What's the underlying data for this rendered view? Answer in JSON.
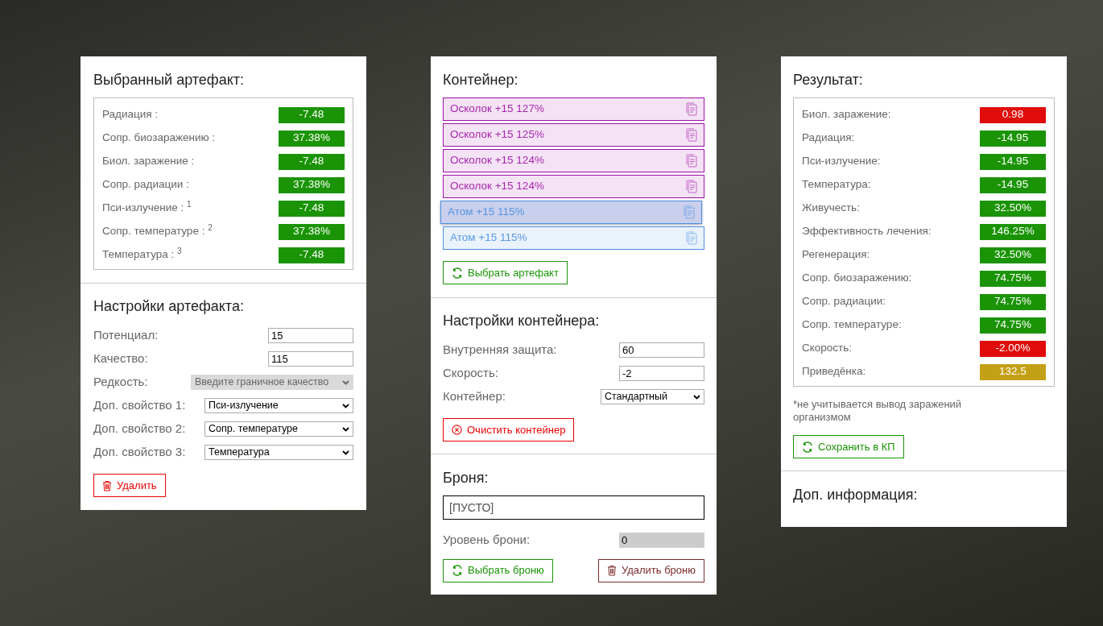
{
  "artifact": {
    "title": "Выбранный артефакт:",
    "stats": [
      {
        "label": "Радиация :",
        "value": "-7.48",
        "color": "#1a9406"
      },
      {
        "label": "Сопр. биозаражению :",
        "value": "37.38%",
        "color": "#1a9406"
      },
      {
        "label": "Биол. заражение :",
        "value": "-7.48",
        "color": "#1a9406"
      },
      {
        "label": "Сопр. радиации :",
        "value": "37.38%",
        "color": "#1a9406"
      },
      {
        "label": "Пси-излучение : $^{1}$",
        "value": "-7.48",
        "color": "#1a9406"
      },
      {
        "label": "Сопр. температуре : $^{2}$",
        "value": "37.38%",
        "color": "#1a9406"
      },
      {
        "label": "Температура : $^{3}$",
        "value": "-7.48",
        "color": "#1a9406"
      }
    ]
  },
  "artifact_settings": {
    "title": "Настройки артефакта:",
    "fields": [
      {
        "kind": "input",
        "label": "Потенциал:",
        "value": "15"
      },
      {
        "kind": "input",
        "label": "Качество:",
        "value": "115"
      },
      {
        "kind": "select",
        "label": "Редкость:",
        "value": "Введите граничное качество",
        "disabled": true
      },
      {
        "kind": "select",
        "label": "Доп. свойство 1:",
        "value": "Пси-излучение",
        "disabled": false
      },
      {
        "kind": "select",
        "label": "Доп. свойство 2:",
        "value": "Сопр. температуре",
        "disabled": false
      },
      {
        "kind": "select",
        "label": "Доп. свойство 3:",
        "value": "Температура",
        "disabled": false
      }
    ],
    "delete_button": "Удалить"
  },
  "container": {
    "title": "Контейнер:",
    "items": [
      {
        "label": "Осколок +15 127%",
        "color": "#a010a8",
        "selected": false
      },
      {
        "label": "Осколок +15 125%",
        "color": "#a010a8",
        "selected": false
      },
      {
        "label": "Осколок +15 124%",
        "color": "#a010a8",
        "selected": false
      },
      {
        "label": "Осколок +15 124%",
        "color": "#a010a8",
        "selected": false
      },
      {
        "label": "Атом +15 115%",
        "color": "#4a90e2",
        "selected": true
      },
      {
        "label": "Атом +15 115%",
        "color": "#4a90e2",
        "selected": false
      }
    ],
    "choose_button": "Выбрать артефакт"
  },
  "container_settings": {
    "title": "Настройки контейнера:",
    "fields": [
      {
        "kind": "input",
        "label": "Внутренняя защита:",
        "value": "60"
      },
      {
        "kind": "input",
        "label": "Скорость:",
        "value": "-2"
      },
      {
        "kind": "select",
        "label": "Контейнер:",
        "value": "Стандартный",
        "disabled": false
      }
    ],
    "clear_button": "Очистить контейнер"
  },
  "armor": {
    "title": "Броня:",
    "value": "[ПУСТО]",
    "level_label": "Уровень брони:",
    "level_value": "0",
    "choose_button": "Выбрать броню",
    "delete_button": "Удалить броню"
  },
  "result": {
    "title": "Результат:",
    "stats": [
      {
        "label": "Биол. заражение:",
        "value": "0.98",
        "color": "#e00b0b"
      },
      {
        "label": "Радиация:",
        "value": "-14.95",
        "color": "#1a9406"
      },
      {
        "label": "Пси-излучение:",
        "value": "-14.95",
        "color": "#1a9406"
      },
      {
        "label": "Температура:",
        "value": "-14.95",
        "color": "#1a9406"
      },
      {
        "label": "Живучесть:",
        "value": "32.50%",
        "color": "#1a9406"
      },
      {
        "label": "Эффективность лечения:",
        "value": "146.25%",
        "color": "#1a9406"
      },
      {
        "label": "Регенерация:",
        "value": "32.50%",
        "color": "#1a9406"
      },
      {
        "label": "Сопр. биозаражению:",
        "value": "74.75%",
        "color": "#1a9406"
      },
      {
        "label": "Сопр. радиации:",
        "value": "74.75%",
        "color": "#1a9406"
      },
      {
        "label": "Сопр. температуре:",
        "value": "74.75%",
        "color": "#1a9406"
      },
      {
        "label": "Скорость:",
        "value": "-2.00%",
        "color": "#e00b0b"
      },
      {
        "label": "Приведёнка:",
        "value": "132.5",
        "color": "#c4a016"
      }
    ],
    "note": "*не учитывается вывод заражений организмом",
    "save_button": "Сохранить в КП",
    "extra_title": "Доп. информация:"
  }
}
